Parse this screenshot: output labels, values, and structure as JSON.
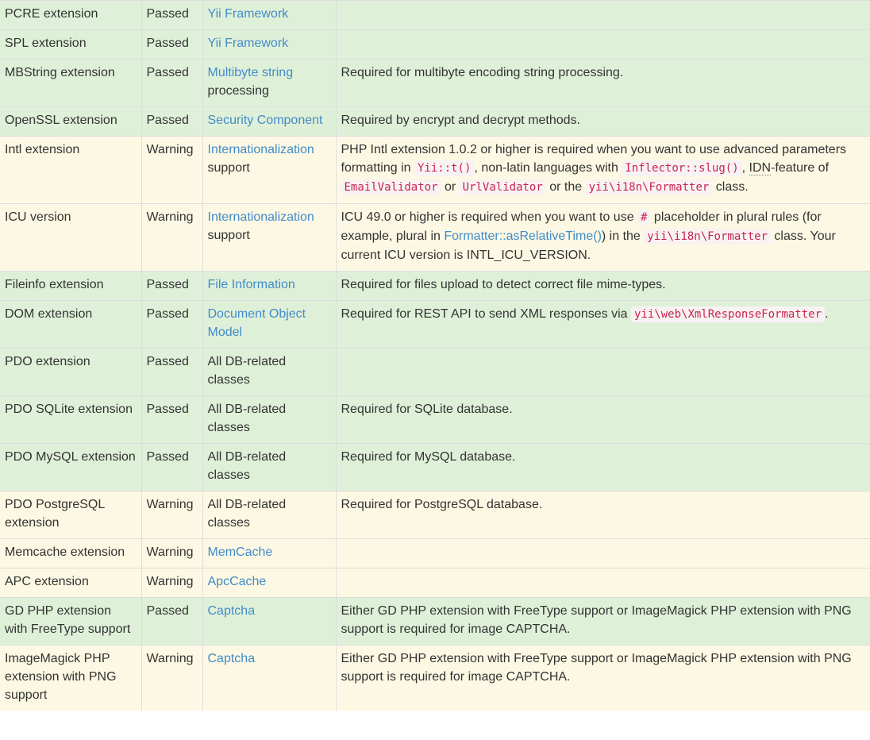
{
  "rows": [
    {
      "name": "PCRE extension",
      "result": "Passed",
      "req_link": "Yii Framework",
      "req_text": "",
      "memo": ""
    },
    {
      "name": "SPL extension",
      "result": "Passed",
      "req_link": "Yii Framework",
      "req_text": "",
      "memo": ""
    },
    {
      "name": "MBString extension",
      "result": "Passed",
      "req_link": "Multibyte string",
      "req_text": "processing",
      "memo": "Required for multibyte encoding string processing."
    },
    {
      "name": "OpenSSL extension",
      "result": "Passed",
      "req_link": "Security Component",
      "req_text": "",
      "memo": "Required by encrypt and decrypt methods."
    },
    {
      "name": "Intl extension",
      "result": "Warning",
      "req_link": "Internationalization",
      "req_text": "support",
      "memo_parts": {
        "t1": "PHP Intl extension 1.0.2 or higher is required when you want to use advanced parameters formatting in ",
        "c1": "Yii::t()",
        "t2": ", non-latin languages with ",
        "c2": "Inflector::slug()",
        "t3": ", ",
        "abbr": "IDN",
        "t4": "-feature of ",
        "c3": "EmailValidator",
        "t5": " or ",
        "c4": "UrlValidator",
        "t6": " or the ",
        "c5": "yii\\i18n\\Formatter",
        "t7": " class."
      }
    },
    {
      "name": "ICU version",
      "result": "Warning",
      "req_link": "Internationalization",
      "req_text": "support",
      "memo_parts": {
        "t1": "ICU 49.0 or higher is required when you want to use ",
        "c1": "#",
        "t2": " placeholder in plural rules (for example, plural in ",
        "link": "Formatter::asRelativeTime()",
        "t3": ") in the ",
        "c2": "yii\\i18n\\Formatter",
        "t4": " class. Your current ICU version is INTL_ICU_VERSION."
      }
    },
    {
      "name": "Fileinfo extension",
      "result": "Passed",
      "req_link": "File Information",
      "req_text": "",
      "memo": "Required for files upload to detect correct file mime-types."
    },
    {
      "name": "DOM extension",
      "result": "Passed",
      "req_link": "Document Object Model",
      "req_text": "",
      "memo_parts": {
        "t1": "Required for REST API to send XML responses via ",
        "c1": "yii\\web\\XmlResponseFormatter",
        "t2": "."
      }
    },
    {
      "name": "PDO extension",
      "result": "Passed",
      "req_link": "",
      "req_text": "All DB-related classes",
      "memo": ""
    },
    {
      "name": "PDO SQLite extension",
      "result": "Passed",
      "req_link": "",
      "req_text": "All DB-related classes",
      "memo": "Required for SQLite database."
    },
    {
      "name": "PDO MySQL extension",
      "result": "Passed",
      "req_link": "",
      "req_text": "All DB-related classes",
      "memo": "Required for MySQL database."
    },
    {
      "name": "PDO PostgreSQL extension",
      "result": "Warning",
      "req_link": "",
      "req_text": "All DB-related classes",
      "memo": "Required for PostgreSQL database."
    },
    {
      "name": "Memcache extension",
      "result": "Warning",
      "req_link": "MemCache",
      "req_text": "",
      "memo": ""
    },
    {
      "name": "APC extension",
      "result": "Warning",
      "req_link": "ApcCache",
      "req_text": "",
      "memo": ""
    },
    {
      "name": "GD PHP extension with FreeType support",
      "result": "Passed",
      "req_link": "Captcha",
      "req_text": "",
      "memo": "Either GD PHP extension with FreeType support or ImageMagick PHP extension with PNG support is required for image CAPTCHA."
    },
    {
      "name": "ImageMagick PHP extension with PNG support",
      "result": "Warning",
      "req_link": "Captcha",
      "req_text": "",
      "memo": "Either GD PHP extension with FreeType support or ImageMagick PHP extension with PNG support is required for image CAPTCHA."
    }
  ],
  "colors": {
    "passed_bg": "#dff0d8",
    "warning_bg": "#fcf8e3",
    "link": "#428bca",
    "code": "#c7254e",
    "code_bg": "#f9f2f4"
  }
}
